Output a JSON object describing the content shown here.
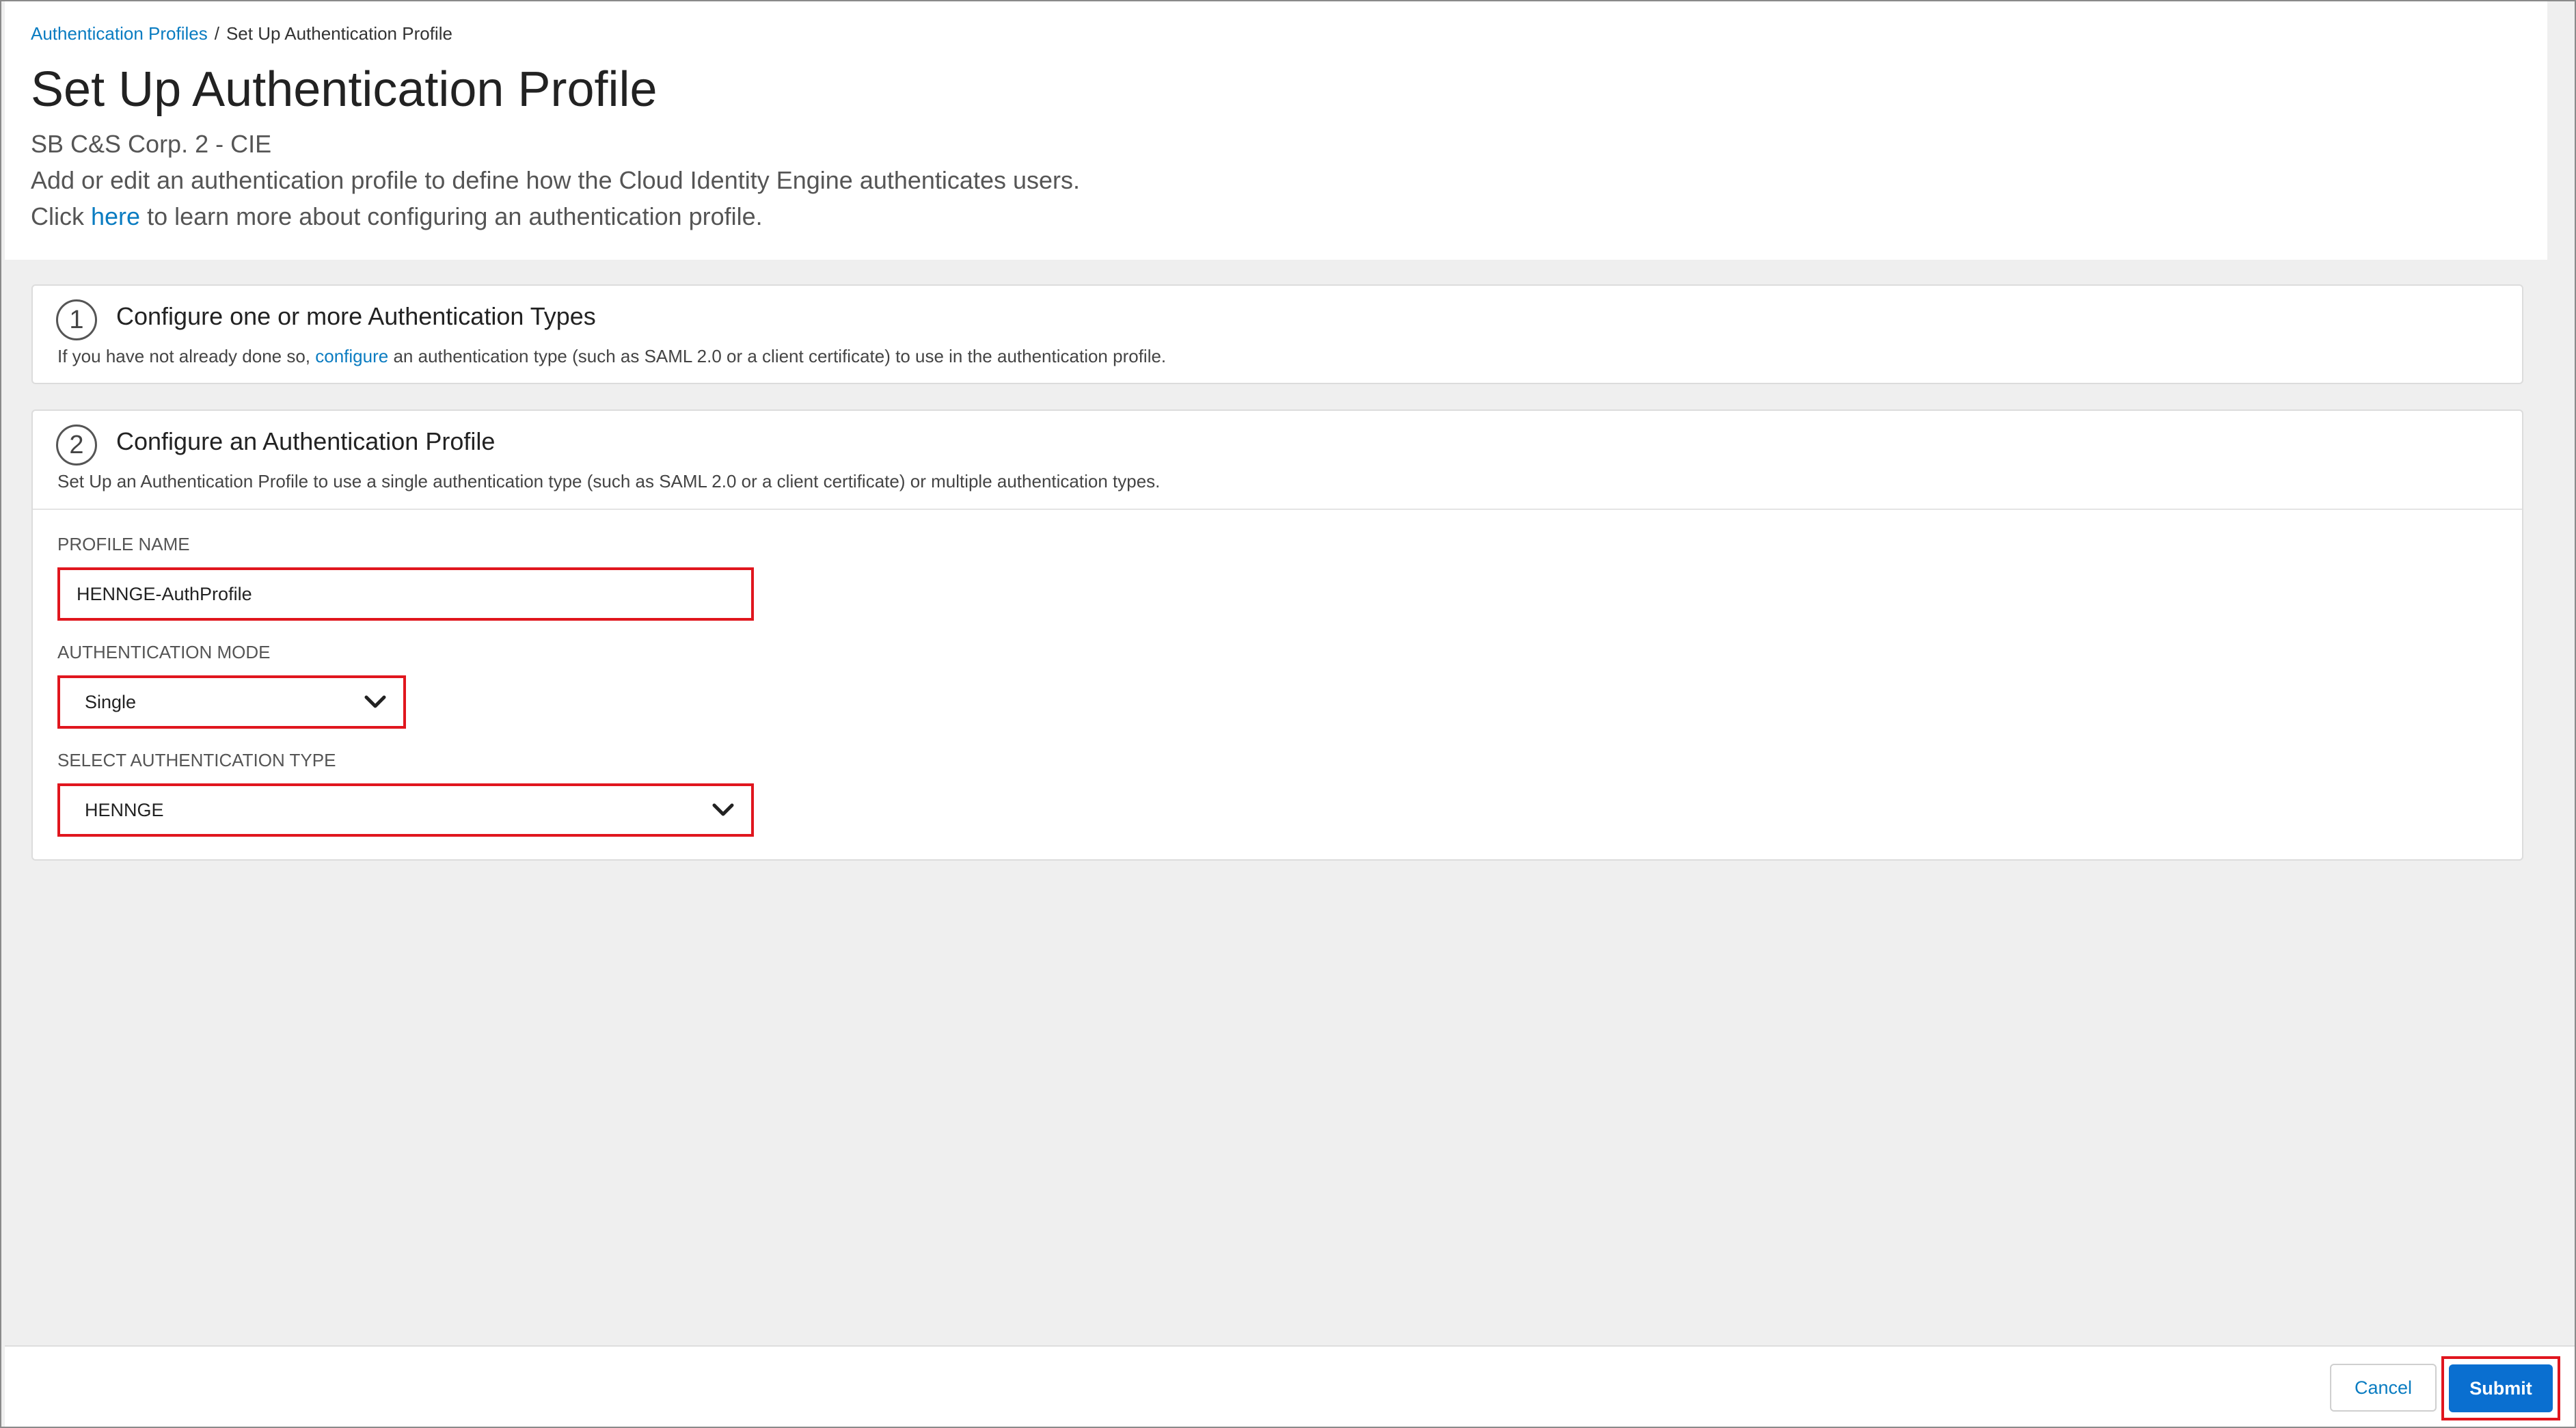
{
  "breadcrumb": {
    "parent": "Authentication Profiles",
    "separator": "/",
    "current": "Set Up Authentication Profile"
  },
  "header": {
    "title": "Set Up Authentication Profile",
    "subtitle": "SB C&S Corp. 2 - CIE",
    "description": "Add or edit an authentication profile to define how the Cloud Identity Engine authenticates users.",
    "learn_prefix": "Click",
    "learn_link": "here",
    "learn_suffix": "to learn more about configuring an authentication profile."
  },
  "step1": {
    "number": "1",
    "title": "Configure one or more Authentication Types",
    "desc_prefix": "If you have not already done so,",
    "desc_link": "configure",
    "desc_suffix": "an authentication type (such as SAML 2.0 or a client certificate) to use in the authentication profile."
  },
  "step2": {
    "number": "2",
    "title": "Configure an Authentication Profile",
    "description": "Set Up an Authentication Profile to use a single authentication type (such as SAML 2.0 or a client certificate) or multiple authentication types."
  },
  "form": {
    "profile_name_label": "PROFILE NAME",
    "profile_name_value": "HENNGE-AuthProfile",
    "auth_mode_label": "AUTHENTICATION MODE",
    "auth_mode_value": "Single",
    "auth_type_label": "SELECT AUTHENTICATION TYPE",
    "auth_type_value": "HENNGE"
  },
  "footer": {
    "cancel_label": "Cancel",
    "submit_label": "Submit"
  },
  "colors": {
    "accent": "#0a6fd0",
    "link": "#0a7cc1",
    "highlight": "#e0161e",
    "background": "#efefef"
  },
  "icons": {
    "dropdown": "chevron-down-icon"
  }
}
